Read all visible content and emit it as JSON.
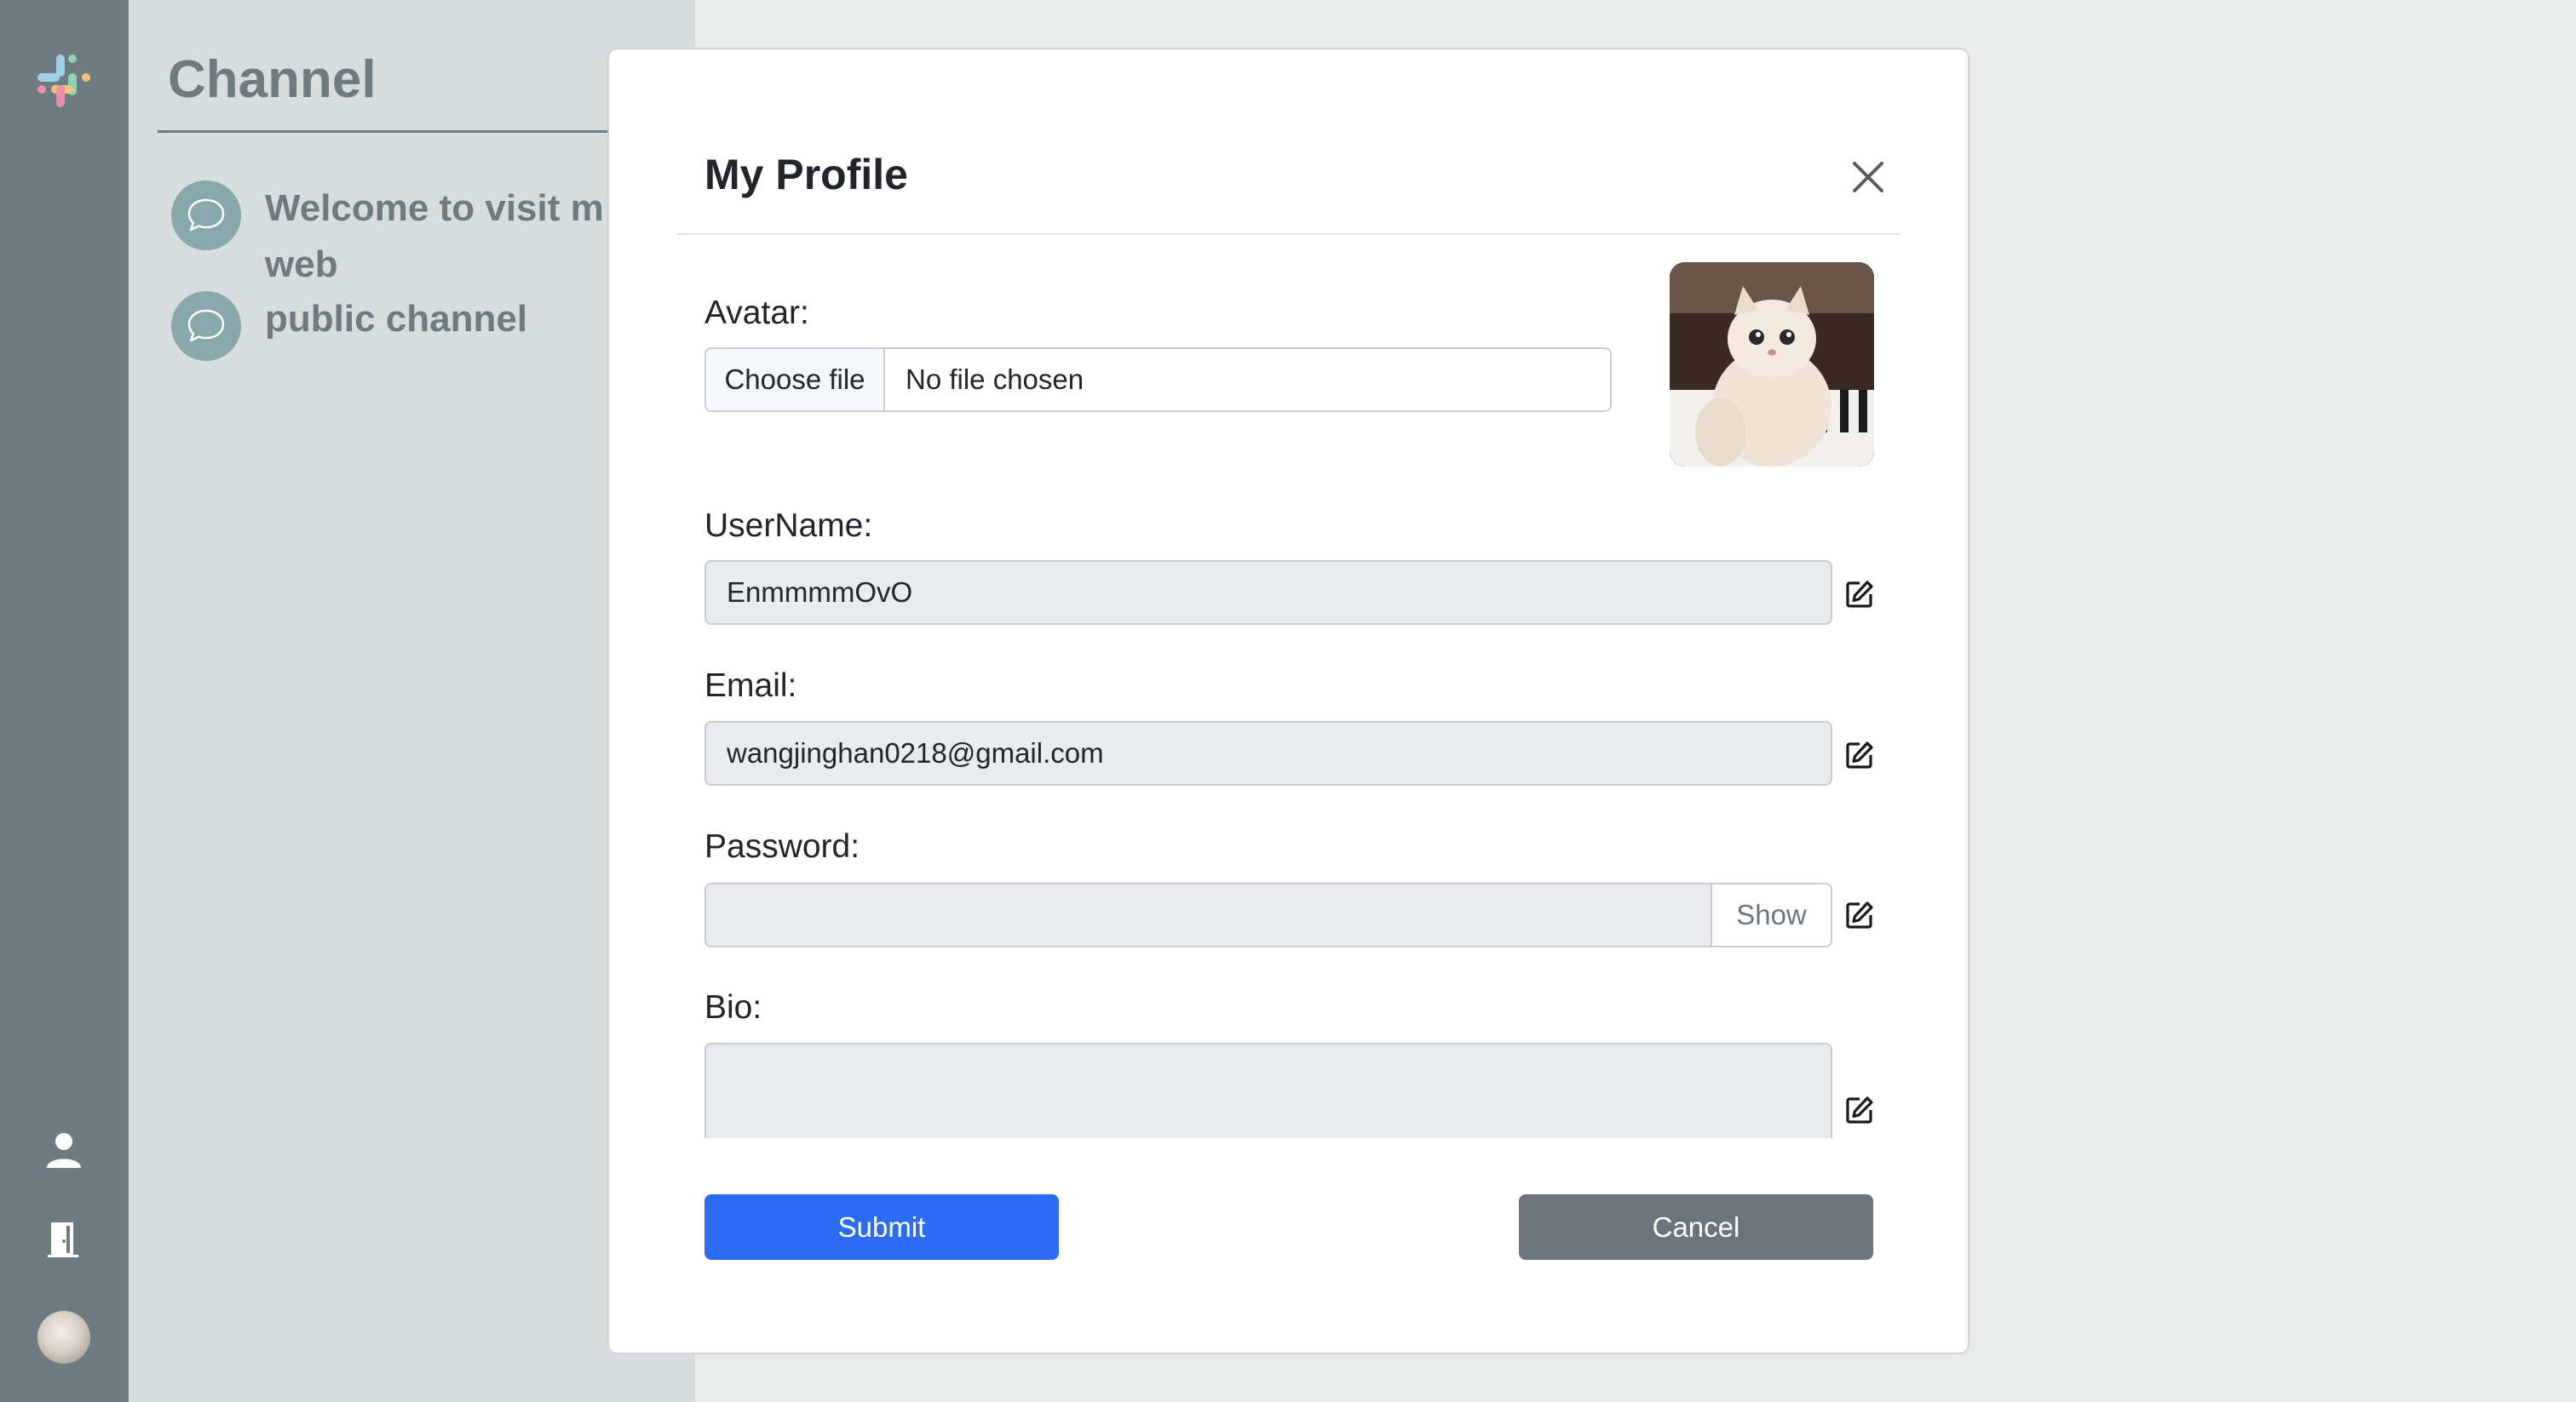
{
  "sidebar": {
    "icons": [
      "slack-logo-icon",
      "user-icon",
      "door-exit-icon",
      "user-avatar"
    ]
  },
  "channels": {
    "title": "Channel",
    "items": [
      {
        "label": "Welcome to visit m web"
      },
      {
        "label": "public channel"
      }
    ]
  },
  "modal": {
    "title": "My Profile",
    "avatar_label": "Avatar:",
    "choose_file_label": "Choose file",
    "file_status": "No file chosen",
    "username_label": "UserName:",
    "username_value": "EnmmmmOvO",
    "email_label": "Email:",
    "email_value": "wangjinghan0218@gmail.com",
    "password_label": "Password:",
    "password_value": "",
    "show_label": "Show",
    "bio_label": "Bio:",
    "bio_value": "",
    "submit_label": "Submit",
    "cancel_label": "Cancel"
  },
  "colors": {
    "rail": "#6e7b81",
    "panel": "#d7dcdc",
    "submit": "#2c6cf5",
    "cancel": "#6c757d",
    "bubble": "#87a9ab"
  }
}
